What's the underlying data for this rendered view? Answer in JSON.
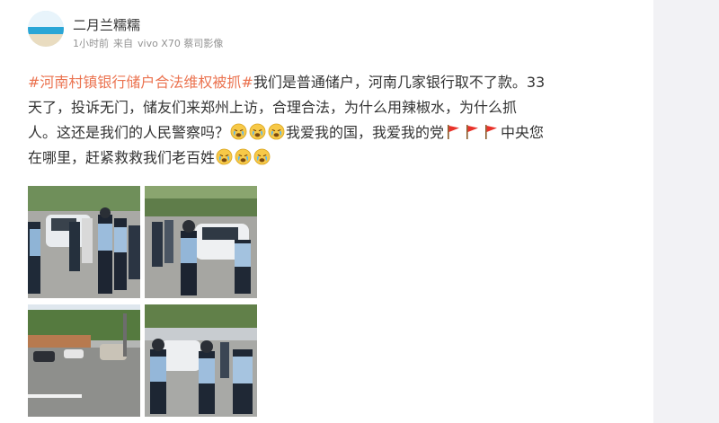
{
  "post": {
    "username": "二月兰糯糯",
    "time": "1小时前",
    "source_prefix": "来自",
    "source": "vivo X70 蔡司影像",
    "topic": "#河南村镇银行储户合法维权被抓#",
    "line1_rest": "我们是普通储户，河南几家银行取不了款。33",
    "line2": "天了，投诉无门，储友们来郑州上访，合理合法，为什么用辣椒水，为什么抓",
    "line3_a": "人。这还是我们的人民警察吗？",
    "line3_b": "我爱我的国，我爱我的党",
    "line3_c": "中央您",
    "line4_a": "在哪里，赶紧救救我们老百姓",
    "emoji_names": [
      "crying-face-icon",
      "red-flag-icon"
    ],
    "images": [
      {
        "name": "photo-1"
      },
      {
        "name": "photo-2"
      },
      {
        "name": "photo-3"
      },
      {
        "name": "photo-4"
      }
    ]
  },
  "colors": {
    "topic": "#eb7350",
    "text": "#333333",
    "meta": "#939393",
    "background": "#f2f2f5"
  }
}
